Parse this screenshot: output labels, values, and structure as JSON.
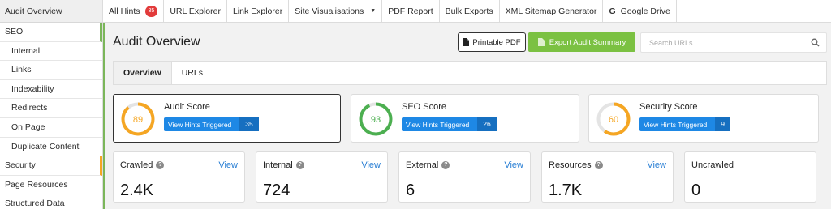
{
  "sidebar": {
    "title": "Audit Overview",
    "items": [
      {
        "label": "SEO"
      },
      {
        "label": "Internal"
      },
      {
        "label": "Links"
      },
      {
        "label": "Indexability"
      },
      {
        "label": "Redirects"
      },
      {
        "label": "On Page"
      },
      {
        "label": "Duplicate Content"
      },
      {
        "label": "Security"
      },
      {
        "label": "Page Resources"
      },
      {
        "label": "Structured Data"
      }
    ]
  },
  "topnav": {
    "all_hints": "All Hints",
    "all_hints_count": "35",
    "url_explorer": "URL Explorer",
    "link_explorer": "Link Explorer",
    "site_visualisations": "Site Visualisations",
    "pdf_report": "PDF Report",
    "bulk_exports": "Bulk Exports",
    "xml_sitemap": "XML Sitemap Generator",
    "google_drive": "Google Drive"
  },
  "main": {
    "title": "Audit Overview",
    "printable_pdf": "Printable PDF",
    "export_summary": "Export Audit Summary",
    "search_placeholder": "Search URLs...",
    "tabs": [
      {
        "label": "Overview"
      },
      {
        "label": "URLs"
      }
    ]
  },
  "scores": [
    {
      "title": "Audit Score",
      "value": "89",
      "percent": 89,
      "color": "#f5a623",
      "hint_label": "View Hints Triggered",
      "hint_count": "35"
    },
    {
      "title": "SEO Score",
      "value": "93",
      "percent": 93,
      "color": "#4caf50",
      "hint_label": "View Hints Triggered",
      "hint_count": "26"
    },
    {
      "title": "Security Score",
      "value": "60",
      "percent": 60,
      "color": "#f5a623",
      "hint_label": "View Hints Triggered",
      "hint_count": "9"
    }
  ],
  "stats": [
    {
      "label": "Crawled",
      "value": "2.4K",
      "view": "View"
    },
    {
      "label": "Internal",
      "value": "724",
      "view": "View"
    },
    {
      "label": "External",
      "value": "6",
      "view": "View"
    },
    {
      "label": "Resources",
      "value": "1.7K",
      "view": "View"
    },
    {
      "label": "Uncrawled",
      "value": "0",
      "view": ""
    }
  ],
  "colors": {
    "accent_green": "#7bc142",
    "blue": "#1e88e5",
    "badge_red": "#e23b3b",
    "orange": "#f5a623"
  }
}
